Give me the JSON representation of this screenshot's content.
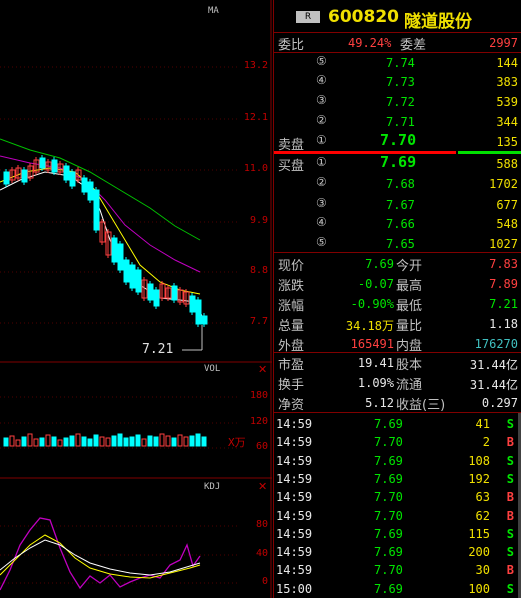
{
  "chart": {
    "main_indicator": "MA",
    "vol_indicator": "VOL",
    "kdj_indicator": "KDJ",
    "price_axis": [
      "13.2",
      "12.1",
      "11.0",
      "9.9",
      "8.8",
      "7.7"
    ],
    "vol_axis": [
      "180",
      "120",
      "60"
    ],
    "vol_unit": "X万",
    "kdj_axis": [
      "80",
      "40",
      "0"
    ],
    "low_marker": "7.21",
    "colors": {
      "up": "#ff4040",
      "down": "#00ffff",
      "ma5": "#ffffff",
      "ma10": "#ffff00",
      "ma20": "#ff00ff",
      "ma60": "#00ff00"
    }
  },
  "header": {
    "badge": "R",
    "code": "600820",
    "name": "隧道股份"
  },
  "order_ratio": {
    "wb_label": "委比",
    "wb_value": "49.24%",
    "wc_label": "委差",
    "wc_value": "2997"
  },
  "sell_label": "卖盘",
  "buy_label": "买盘",
  "asks": [
    {
      "level": "⑤",
      "price": "7.74",
      "vol": "144"
    },
    {
      "level": "④",
      "price": "7.73",
      "vol": "383"
    },
    {
      "level": "③",
      "price": "7.72",
      "vol": "539"
    },
    {
      "level": "②",
      "price": "7.71",
      "vol": "344"
    },
    {
      "level": "①",
      "price": "7.70",
      "vol": "135"
    }
  ],
  "bids": [
    {
      "level": "①",
      "price": "7.69",
      "vol": "588"
    },
    {
      "level": "②",
      "price": "7.68",
      "vol": "1702"
    },
    {
      "level": "③",
      "price": "7.67",
      "vol": "677"
    },
    {
      "level": "④",
      "price": "7.66",
      "vol": "548"
    },
    {
      "level": "⑤",
      "price": "7.65",
      "vol": "1027"
    }
  ],
  "quote": [
    {
      "l1": "现价",
      "v1": "7.69",
      "l2": "今开",
      "v2": "7.83"
    },
    {
      "l1": "涨跌",
      "v1": "-0.07",
      "l2": "最高",
      "v2": "7.89"
    },
    {
      "l1": "涨幅",
      "v1": "-0.90%",
      "l2": "最低",
      "v2": "7.21"
    },
    {
      "l1": "总量",
      "v1": "34.18万",
      "l2": "量比",
      "v2": "1.18"
    },
    {
      "l1": "外盘",
      "v1": "165491",
      "l2": "内盘",
      "v2": "176270"
    }
  ],
  "fund": [
    {
      "l1": "市盈",
      "v1": "19.41",
      "l2": "股本",
      "v2": "31.44亿"
    },
    {
      "l1": "换手",
      "v1": "1.09%",
      "l2": "流通",
      "v2": "31.44亿"
    },
    {
      "l1": "净资",
      "v1": "5.12",
      "l2": "收益(三)",
      "v2": "0.297"
    }
  ],
  "ticks": [
    {
      "time": "14:59",
      "price": "7.69",
      "vol": "41",
      "side": "S"
    },
    {
      "time": "14:59",
      "price": "7.70",
      "vol": "2",
      "side": "B"
    },
    {
      "time": "14:59",
      "price": "7.69",
      "vol": "108",
      "side": "S"
    },
    {
      "time": "14:59",
      "price": "7.69",
      "vol": "192",
      "side": "S"
    },
    {
      "time": "14:59",
      "price": "7.70",
      "vol": "63",
      "side": "B"
    },
    {
      "time": "14:59",
      "price": "7.70",
      "vol": "62",
      "side": "B"
    },
    {
      "time": "14:59",
      "price": "7.69",
      "vol": "115",
      "side": "S"
    },
    {
      "time": "14:59",
      "price": "7.69",
      "vol": "200",
      "side": "S"
    },
    {
      "time": "14:59",
      "price": "7.70",
      "vol": "30",
      "side": "B"
    },
    {
      "time": "15:00",
      "price": "7.69",
      "vol": "100",
      "side": "S"
    }
  ]
}
